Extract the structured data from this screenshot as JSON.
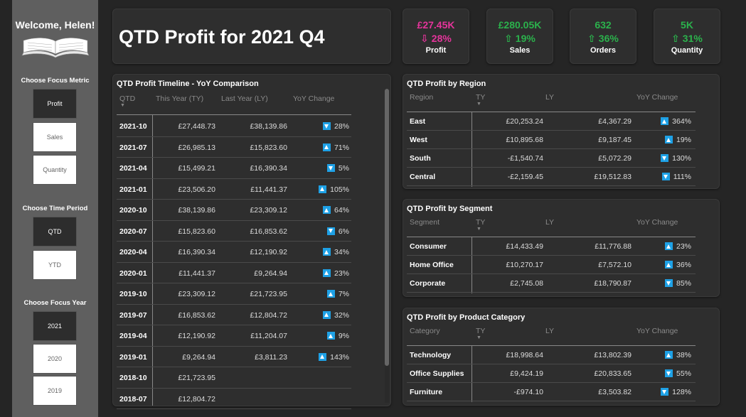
{
  "sidebar": {
    "welcome": "Welcome, Helen!",
    "focus_metric_label": "Choose Focus Metric",
    "metrics": [
      "Profit",
      "Sales",
      "Quantity"
    ],
    "time_period_label": "Choose Time Period",
    "periods": [
      "QTD",
      "YTD"
    ],
    "focus_year_label": "Choose Focus Year",
    "years": [
      "2021",
      "2020",
      "2019"
    ]
  },
  "title": "QTD Profit for 2021 Q4",
  "kpis": [
    {
      "value": "£27.45K",
      "change": "28%",
      "direction": "down",
      "label": "Profit",
      "color": "#e5349b"
    },
    {
      "value": "£280.05K",
      "change": "19%",
      "direction": "up",
      "label": "Sales",
      "color": "#2bb24c"
    },
    {
      "value": "632",
      "change": "36%",
      "direction": "up",
      "label": "Orders",
      "color": "#2bb24c"
    },
    {
      "value": "5K",
      "change": "31%",
      "direction": "up",
      "label": "Quantity",
      "color": "#2bb24c"
    }
  ],
  "timeline": {
    "title": "QTD Profit Timeline - YoY Comparison",
    "headers": [
      "QTD",
      "This Year (TY)",
      "Last Year (LY)",
      "YoY Change"
    ],
    "rows": [
      {
        "q": "2021-10",
        "ty": "£27,448.73",
        "ly": "£38,139.86",
        "dir": "down",
        "chg": "28%"
      },
      {
        "q": "2021-07",
        "ty": "£26,985.13",
        "ly": "£15,823.60",
        "dir": "up",
        "chg": "71%"
      },
      {
        "q": "2021-04",
        "ty": "£15,499.21",
        "ly": "£16,390.34",
        "dir": "down",
        "chg": "5%"
      },
      {
        "q": "2021-01",
        "ty": "£23,506.20",
        "ly": "£11,441.37",
        "dir": "up",
        "chg": "105%"
      },
      {
        "q": "2020-10",
        "ty": "£38,139.86",
        "ly": "£23,309.12",
        "dir": "up",
        "chg": "64%"
      },
      {
        "q": "2020-07",
        "ty": "£15,823.60",
        "ly": "£16,853.62",
        "dir": "down",
        "chg": "6%"
      },
      {
        "q": "2020-04",
        "ty": "£16,390.34",
        "ly": "£12,190.92",
        "dir": "up",
        "chg": "34%"
      },
      {
        "q": "2020-01",
        "ty": "£11,441.37",
        "ly": "£9,264.94",
        "dir": "up",
        "chg": "23%"
      },
      {
        "q": "2019-10",
        "ty": "£23,309.12",
        "ly": "£21,723.95",
        "dir": "up",
        "chg": "7%"
      },
      {
        "q": "2019-07",
        "ty": "£16,853.62",
        "ly": "£12,804.72",
        "dir": "up",
        "chg": "32%"
      },
      {
        "q": "2019-04",
        "ty": "£12,190.92",
        "ly": "£11,204.07",
        "dir": "up",
        "chg": "9%"
      },
      {
        "q": "2019-01",
        "ty": "£9,264.94",
        "ly": "£3,811.23",
        "dir": "up",
        "chg": "143%"
      },
      {
        "q": "2018-10",
        "ty": "£21,723.95",
        "ly": "",
        "dir": "",
        "chg": ""
      },
      {
        "q": "2018-07",
        "ty": "£12,804.72",
        "ly": "",
        "dir": "",
        "chg": ""
      }
    ]
  },
  "region": {
    "title": "QTD Profit by Region",
    "headers": [
      "Region",
      "TY",
      "LY",
      "YoY Change"
    ],
    "rows": [
      {
        "name": "East",
        "ty": "£20,253.24",
        "ly": "£4,367.29",
        "dir": "up",
        "chg": "364%"
      },
      {
        "name": "West",
        "ty": "£10,895.68",
        "ly": "£9,187.45",
        "dir": "up",
        "chg": "19%"
      },
      {
        "name": "South",
        "ty": "-£1,540.74",
        "ly": "£5,072.29",
        "dir": "down",
        "chg": "130%"
      },
      {
        "name": "Central",
        "ty": "-£2,159.45",
        "ly": "£19,512.83",
        "dir": "down",
        "chg": "111%"
      }
    ]
  },
  "segment": {
    "title": "QTD Profit by Segment",
    "headers": [
      "Segment",
      "TY",
      "LY",
      "YoY Change"
    ],
    "rows": [
      {
        "name": "Consumer",
        "ty": "£14,433.49",
        "ly": "£11,776.88",
        "dir": "up",
        "chg": "23%"
      },
      {
        "name": "Home Office",
        "ty": "£10,270.17",
        "ly": "£7,572.10",
        "dir": "up",
        "chg": "36%"
      },
      {
        "name": "Corporate",
        "ty": "£2,745.08",
        "ly": "£18,790.87",
        "dir": "down",
        "chg": "85%"
      }
    ]
  },
  "category": {
    "title": "QTD Profit by Product Category",
    "headers": [
      "Category",
      "TY",
      "LY",
      "YoY Change"
    ],
    "rows": [
      {
        "name": "Technology",
        "ty": "£18,998.64",
        "ly": "£13,802.39",
        "dir": "up",
        "chg": "38%"
      },
      {
        "name": "Office Supplies",
        "ty": "£9,424.19",
        "ly": "£20,833.65",
        "dir": "down",
        "chg": "55%"
      },
      {
        "name": "Furniture",
        "ty": "-£974.10",
        "ly": "£3,503.82",
        "dir": "down",
        "chg": "128%"
      }
    ]
  }
}
